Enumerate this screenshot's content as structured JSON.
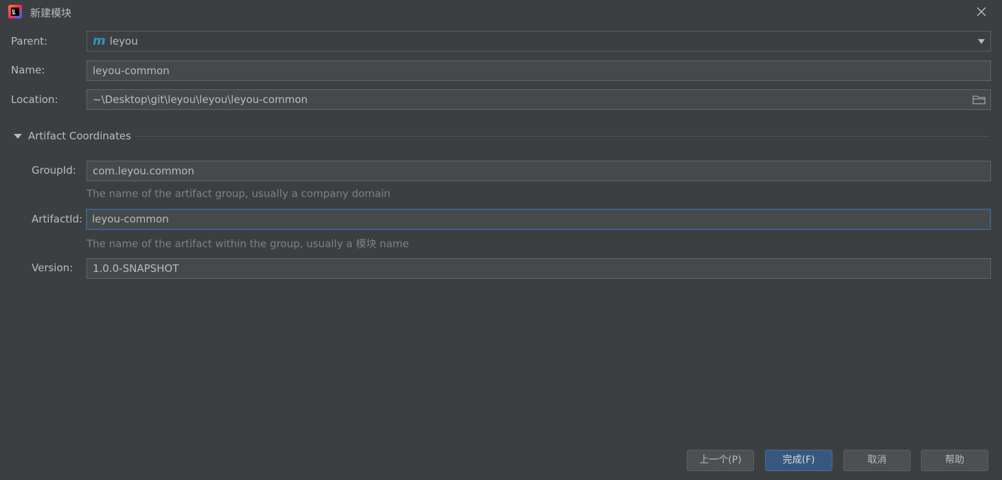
{
  "window": {
    "title": "新建模块"
  },
  "icons": {
    "app": "intellij-idea-icon",
    "close": "close-icon",
    "maven": "maven-m-icon",
    "dropdown": "chevron-down-icon",
    "folder": "folder-icon",
    "collapse": "triangle-down-icon"
  },
  "colors": {
    "background": "#3c3f41",
    "field": "#45494a",
    "accent": "#365880",
    "maven": "#3592c4",
    "focus": "#3d6185"
  },
  "form": {
    "parent": {
      "label": "Parent:",
      "value": "leyou",
      "logo": "m"
    },
    "name": {
      "label": "Name:",
      "value": "leyou-common"
    },
    "location": {
      "label": "Location:",
      "value": "~\\Desktop\\git\\leyou\\leyou\\leyou-common"
    }
  },
  "artifact": {
    "section_label": "Artifact Coordinates",
    "group_id": {
      "label": "GroupId:",
      "value": "com.leyou.common",
      "hint": "The name of the artifact group, usually a company domain"
    },
    "artifact_id": {
      "label": "ArtifactId:",
      "value": "leyou-common",
      "hint": "The name of the artifact within the group, usually a 模块 name"
    },
    "version": {
      "label": "Version:",
      "value": "1.0.0-SNAPSHOT"
    }
  },
  "buttons": {
    "previous": "上一个(P)",
    "finish": "完成(F)",
    "cancel": "取消",
    "help": "帮助"
  }
}
